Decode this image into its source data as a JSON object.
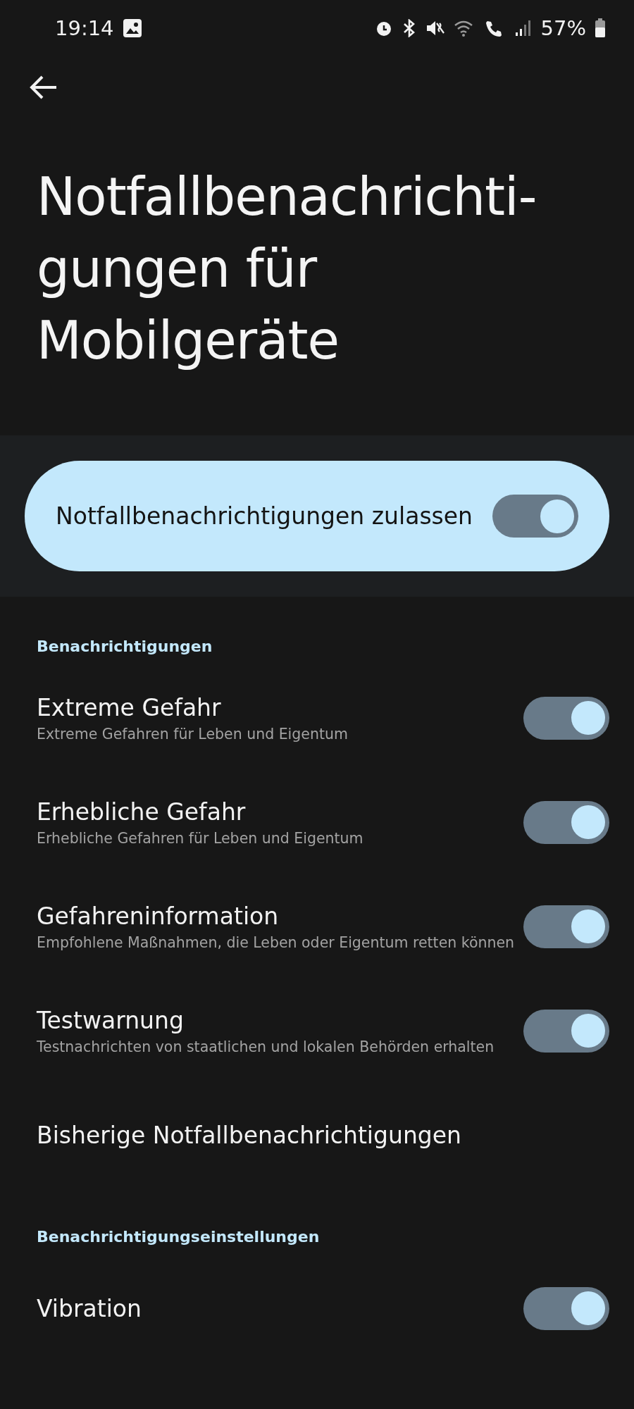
{
  "status_bar": {
    "time": "19:14",
    "battery": "57%"
  },
  "title": "Notfallbenachrichti-\ngungen für\nMobilgeräte",
  "main_switch": {
    "label": "Notfallbenachrichtigungen zulassen",
    "on": true
  },
  "sections": [
    {
      "header": "Benachrichtigungen",
      "items": [
        {
          "kind": "switch",
          "title": "Extreme Gefahr",
          "subtitle": "Extreme Gefahren für Leben und Eigentum",
          "on": true
        },
        {
          "kind": "switch",
          "title": "Erhebliche Gefahr",
          "subtitle": "Erhebliche Gefahren für Leben und Eigentum",
          "on": true
        },
        {
          "kind": "switch",
          "title": "Gefahreninformation",
          "subtitle": "Empfohlene Maßnahmen, die Leben oder Eigentum retten können",
          "on": true
        },
        {
          "kind": "switch",
          "title": "Testwarnung",
          "subtitle": "Testnachrichten von staatlichen und lokalen Behörden erhalten",
          "on": true
        },
        {
          "kind": "link",
          "title": "Bisherige Notfallbenachrichtigungen"
        }
      ]
    },
    {
      "header": "Benachrichtigungseinstellungen",
      "items": [
        {
          "kind": "switch",
          "title": "Vibration",
          "on": true
        }
      ]
    }
  ]
}
